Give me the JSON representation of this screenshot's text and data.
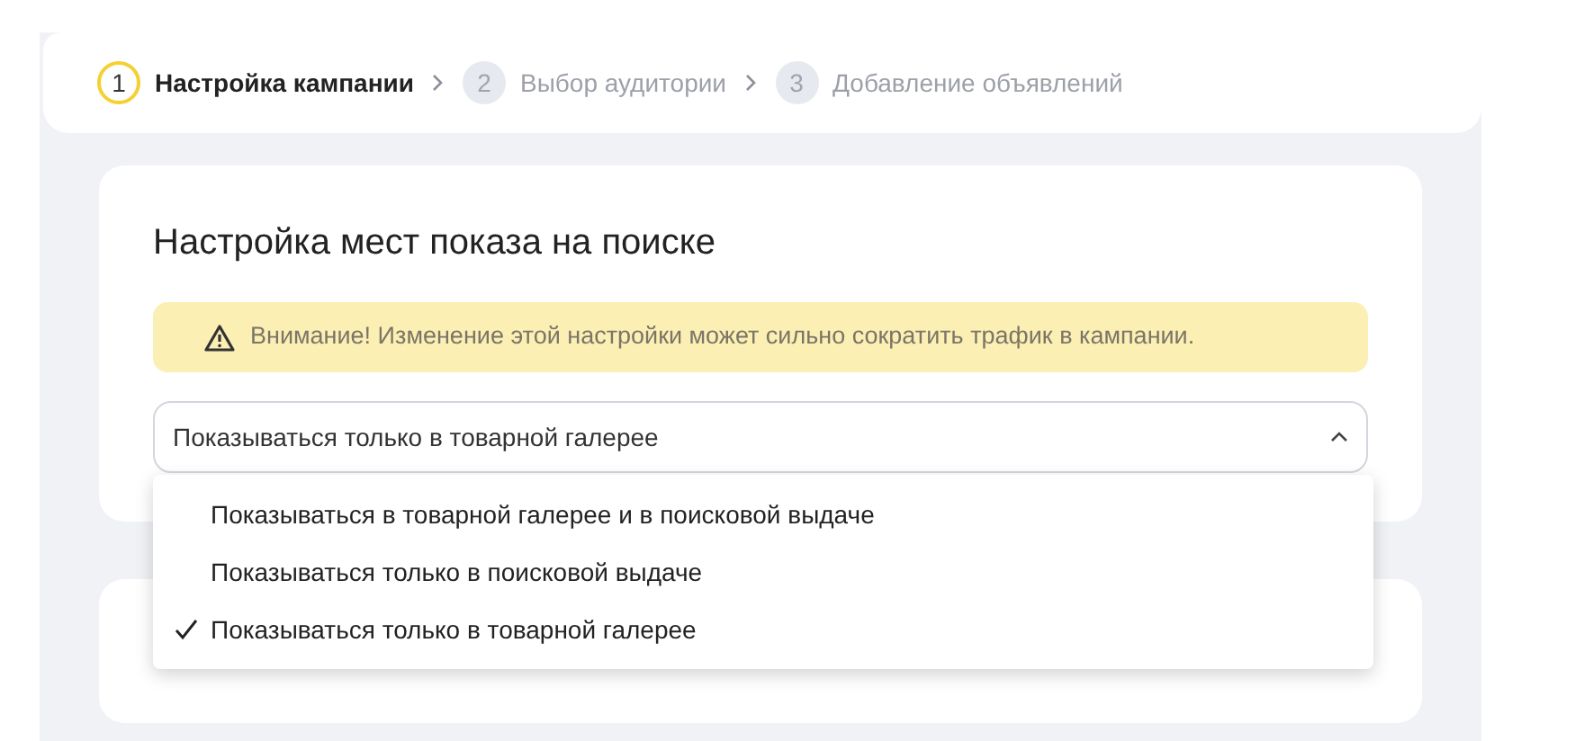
{
  "steps": [
    {
      "number": "1",
      "label": "Настройка кампании",
      "selected": true
    },
    {
      "number": "2",
      "label": "Выбор аудитории",
      "selected": false
    },
    {
      "number": "3",
      "label": "Добавление объявлений",
      "selected": false
    }
  ],
  "section": {
    "title": "Настройка мест показа на поиске",
    "warning": "Внимание! Изменение этой настройки может сильно сократить трафик в кампании.",
    "select": {
      "value": "Показываться только в товарной галерее",
      "expanded": true,
      "options": [
        {
          "label": "Показываться в товарной галерее и в поисковой выдаче",
          "selected": false
        },
        {
          "label": "Показываться только в поисковой выдаче",
          "selected": false
        },
        {
          "label": "Показываться только в товарной галерее",
          "selected": true
        }
      ]
    }
  }
}
